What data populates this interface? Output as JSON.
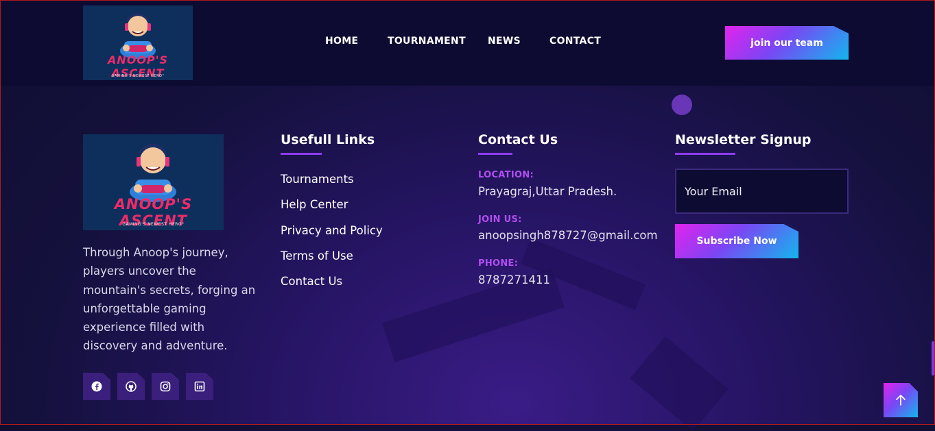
{
  "brand": {
    "name": "ANOOP'S ASCENT",
    "tagline": "GAMING'S NEWEST HERO°"
  },
  "nav": {
    "items": [
      "HOME",
      "TOURNAMENT",
      "NEWS",
      "CONTACT"
    ],
    "cta_label": "join our team"
  },
  "footer": {
    "about_text": "Through Anoop's journey, players uncover the mountain's secrets, forging an unforgettable gaming experience filled with discovery and adventure.",
    "useful_links": {
      "title": "Usefull Links",
      "items": [
        "Tournaments",
        "Help Center",
        "Privacy and Policy",
        "Terms of Use",
        "Contact Us"
      ]
    },
    "contact": {
      "title": "Contact Us",
      "location_label": "LOCATION:",
      "location_value": "Prayagraj,Uttar Pradesh.",
      "join_label": "JOIN US:",
      "join_value": "anoopsingh878727@gmail.com",
      "phone_label": "PHONE:",
      "phone_value": "8787271411"
    },
    "newsletter": {
      "title": "Newsletter Signup",
      "email_placeholder": "Your Email",
      "button_label": "Subscribe Now"
    },
    "social_icons": [
      "facebook-icon",
      "github-icon",
      "instagram-icon",
      "linkedin-icon"
    ]
  },
  "colors": {
    "accent_purple": "#8f3cf0",
    "label_purple": "#b14ff0",
    "brand_pink": "#ee2b6a",
    "gradient_start": "#e223ee",
    "gradient_end": "#12b6ee"
  }
}
